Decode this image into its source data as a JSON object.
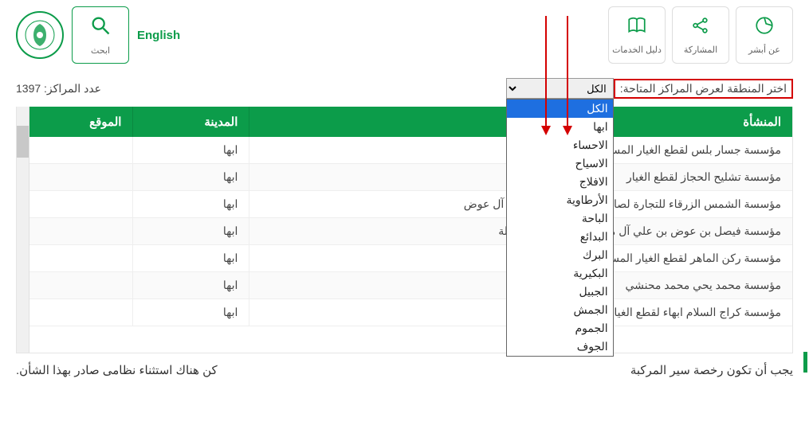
{
  "header": {
    "nav": [
      {
        "label": "عن أبشر"
      },
      {
        "label": "المشاركة"
      },
      {
        "label": "دليل الخدمات"
      }
    ],
    "search_label": "ابحث",
    "english_label": "English"
  },
  "filter": {
    "label": "اختر المنطقة لعرض المراكز المتاحة:",
    "selected": "الكل",
    "count_label": "عدد المراكز: 1397",
    "options": [
      "الكل",
      "ابها",
      "الاحساء",
      "الاسياح",
      "الافلاج",
      "الأرطاوية",
      "الباحة",
      "البدائع",
      "البرك",
      "البكيرية",
      "الجبيل",
      "الجمش",
      "الجموم",
      "الجوف"
    ]
  },
  "table": {
    "headers": {
      "facility": "المنشأة",
      "owner": "",
      "city": "المدينة",
      "location": "الموقع"
    },
    "rows": [
      {
        "facility": "مؤسسة جسار بلس لقطع الغيار المستعملة",
        "owner": "",
        "city": "ابها",
        "location": ""
      },
      {
        "facility": "مؤسسة تشليح الحجاز لقطع الغيار",
        "owner": "",
        "city": "ابها",
        "location": ""
      },
      {
        "facility": "مؤسسة الشمس الزرقاء للتجارة لصاحبها",
        "owner": "محمد آل عوض",
        "city": "ابها",
        "location": ""
      },
      {
        "facility": "مؤسسة فيصل بن عوض بن علي آل مشبب",
        "owner": "ستعملة",
        "city": "ابها",
        "location": ""
      },
      {
        "facility": "مؤسسة ركن الماهر لقطع الغيار المستعملة",
        "owner": "",
        "city": "ابها",
        "location": ""
      },
      {
        "facility": "مؤسسة محمد يحي محمد محنشي",
        "owner": "",
        "city": "ابها",
        "location": ""
      },
      {
        "facility": "مؤسسة كراج السلام ابهاء لقطع الغيار",
        "owner": "",
        "city": "ابها",
        "location": ""
      }
    ]
  },
  "footer": {
    "right": "يجب أن تكون رخصة سير المركبة",
    "left": "كن هناك استثناء نظامى صادر بهذا الشأن."
  }
}
